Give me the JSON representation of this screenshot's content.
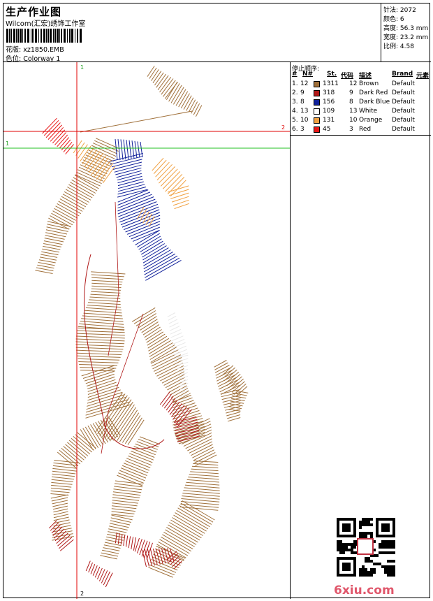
{
  "header": {
    "title": "生产作业图",
    "studio": "Wilcom(汇宏)绣饰工作室",
    "filename_label": "花版:",
    "filename": "xz1850.EMB",
    "colorway_label": "色位:",
    "colorway": "Colorway 1"
  },
  "stats": {
    "stitches": "针法: 2072",
    "colors": "颜色: 6",
    "height": "高度: 56.3 mm",
    "width": "宽度: 23.2 mm",
    "scale": "比例: 4.58"
  },
  "sequence": {
    "title": "停止顺序:",
    "headers": {
      "num": "#",
      "n": "N#",
      "st": "St.",
      "code": "代码",
      "desc": "描述",
      "brand": "Brand",
      "elem": "元素"
    },
    "rows": [
      {
        "idx": "1.",
        "n": "12",
        "color": "#a0703a",
        "st": "1311",
        "code": "12",
        "desc": "Brown",
        "brand": "Default"
      },
      {
        "idx": "2.",
        "n": "9",
        "color": "#b01818",
        "st": "318",
        "code": "9",
        "desc": "Dark Red",
        "brand": "Default"
      },
      {
        "idx": "3.",
        "n": "8",
        "color": "#10209a",
        "st": "156",
        "code": "8",
        "desc": "Dark Blue",
        "brand": "Default"
      },
      {
        "idx": "4.",
        "n": "13",
        "color": "#ffffff",
        "st": "109",
        "code": "13",
        "desc": "White",
        "brand": "Default"
      },
      {
        "idx": "5.",
        "n": "10",
        "color": "#f0a040",
        "st": "131",
        "code": "10",
        "desc": "Orange",
        "brand": "Default"
      },
      {
        "idx": "6.",
        "n": "3",
        "color": "#e81818",
        "st": "45",
        "code": "3",
        "desc": "Red",
        "brand": "Default"
      }
    ]
  },
  "guides": {
    "v1_top": "1",
    "v1_bottom": "2",
    "h1_left": "1",
    "h2_right": "2"
  },
  "watermark": "6xiu.com",
  "colors": {
    "brown": "#a0703a",
    "dark_red": "#b01818",
    "dark_blue": "#10209a",
    "orange": "#f0a040",
    "red": "#e81818",
    "guide_red": "#e00000",
    "guide_green": "#20c020"
  }
}
